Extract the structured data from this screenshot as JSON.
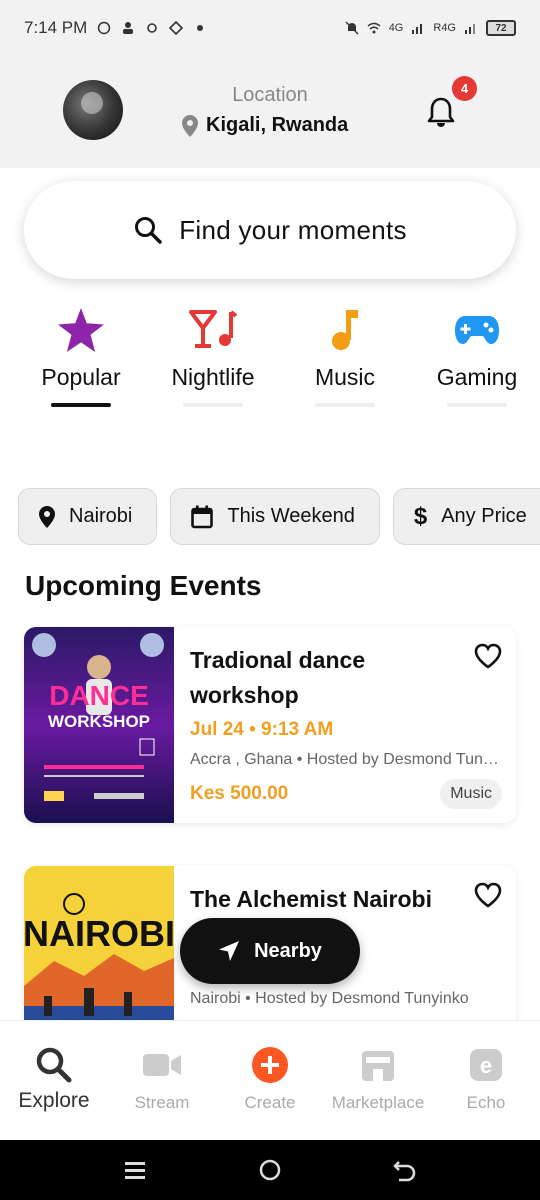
{
  "status_bar": {
    "time": "7:14 PM",
    "battery": "72",
    "network_1": "4G",
    "network_2": "R4G"
  },
  "header": {
    "location_label": "Location",
    "location_value": "Kigali, Rwanda",
    "notification_count": "4"
  },
  "search": {
    "placeholder": "Find your moments"
  },
  "categories": [
    {
      "label": "Popular",
      "icon": "star-icon",
      "color": "#8e24aa",
      "active": true
    },
    {
      "label": "Nightlife",
      "icon": "cocktail-music-icon",
      "color": "#e53935",
      "active": false
    },
    {
      "label": "Music",
      "icon": "music-note-icon",
      "color": "#f29d12",
      "active": false
    },
    {
      "label": "Gaming",
      "icon": "gamepad-icon",
      "color": "#2196f3",
      "active": false
    }
  ],
  "filters": [
    {
      "label": "Nairobi",
      "icon": "location-pin-icon"
    },
    {
      "label": "This Weekend",
      "icon": "calendar-icon"
    },
    {
      "label": "Any Price",
      "icon": "dollar-icon"
    }
  ],
  "section_title": "Upcoming Events",
  "events": [
    {
      "title": "Tradional dance workshop",
      "date": "Jul 24 • 9:13 AM",
      "meta": "Accra , Ghana • Hosted by Desmond Tunyinko",
      "price": "Kes 500.00",
      "tag": "Music",
      "poster_text": "DANCE WORKSHOP"
    },
    {
      "title": "The Alchemist Nairobi",
      "date": "",
      "meta": "Nairobi • Hosted by Desmond Tunyinko",
      "price": "",
      "tag": "",
      "poster_text": "NAIROBI"
    }
  ],
  "nearby_button": "Nearby",
  "bottom_nav": [
    {
      "label": "Explore",
      "icon": "search-icon",
      "active": true
    },
    {
      "label": "Stream",
      "icon": "video-icon",
      "active": false
    },
    {
      "label": "Create",
      "icon": "plus-circle-icon",
      "active": false
    },
    {
      "label": "Marketplace",
      "icon": "store-icon",
      "active": false
    },
    {
      "label": "Echo",
      "icon": "echo-icon",
      "active": false
    }
  ],
  "colors": {
    "accent": "#f0a020",
    "badge": "#e53935",
    "create": "#ff5722"
  }
}
